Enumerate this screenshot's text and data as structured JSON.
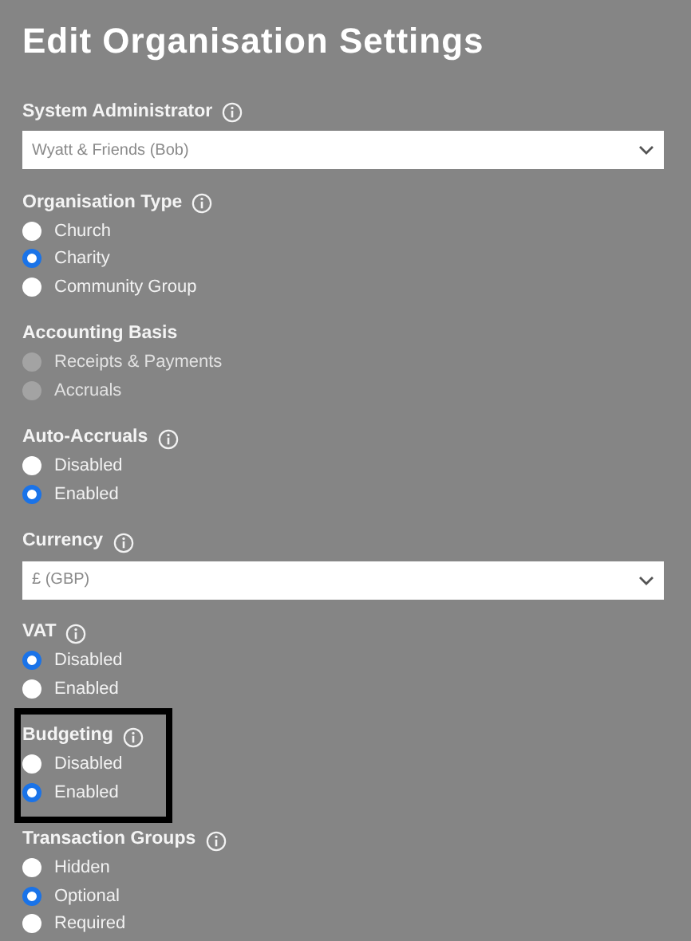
{
  "title": "Edit Organisation Settings",
  "sections": [
    {
      "kind": "select",
      "label": "System Administrator",
      "info": true,
      "highlighted": false,
      "value": "Wyatt & Friends (Bob)"
    },
    {
      "kind": "radio",
      "label": "Organisation Type",
      "info": true,
      "highlighted": false,
      "options": [
        {
          "label": "Church",
          "selected": false,
          "disabled": false
        },
        {
          "label": "Charity",
          "selected": true,
          "disabled": false
        },
        {
          "label": "Community Group",
          "selected": false,
          "disabled": false
        }
      ]
    },
    {
      "kind": "radio",
      "label": "Accounting Basis",
      "info": false,
      "highlighted": false,
      "options": [
        {
          "label": "Receipts & Payments",
          "selected": false,
          "disabled": true
        },
        {
          "label": "Accruals",
          "selected": false,
          "disabled": true
        }
      ]
    },
    {
      "kind": "radio",
      "label": "Auto-Accruals",
      "info": true,
      "highlighted": false,
      "options": [
        {
          "label": "Disabled",
          "selected": false,
          "disabled": false
        },
        {
          "label": "Enabled",
          "selected": true,
          "disabled": false
        }
      ]
    },
    {
      "kind": "select",
      "label": "Currency",
      "info": true,
      "highlighted": false,
      "value": "£ (GBP)"
    },
    {
      "kind": "radio",
      "label": "VAT",
      "info": true,
      "highlighted": false,
      "options": [
        {
          "label": "Disabled",
          "selected": true,
          "disabled": false
        },
        {
          "label": "Enabled",
          "selected": false,
          "disabled": false
        }
      ]
    },
    {
      "kind": "radio",
      "label": "Budgeting",
      "info": true,
      "highlighted": true,
      "options": [
        {
          "label": "Disabled",
          "selected": false,
          "disabled": false
        },
        {
          "label": "Enabled",
          "selected": true,
          "disabled": false
        }
      ]
    },
    {
      "kind": "radio",
      "label": "Transaction Groups",
      "info": true,
      "highlighted": false,
      "options": [
        {
          "label": "Hidden",
          "selected": false,
          "disabled": false
        },
        {
          "label": "Optional",
          "selected": true,
          "disabled": false
        },
        {
          "label": "Required",
          "selected": false,
          "disabled": false
        }
      ]
    }
  ]
}
